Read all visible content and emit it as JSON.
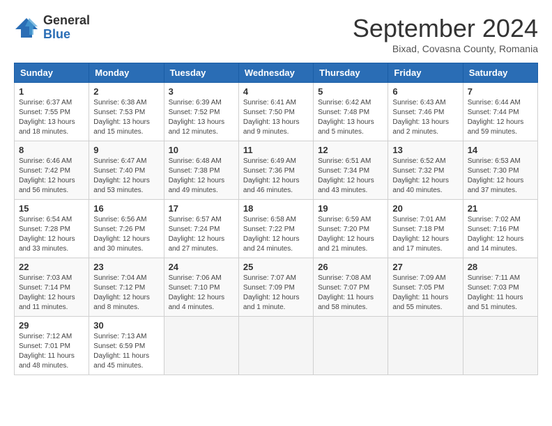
{
  "header": {
    "logo_general": "General",
    "logo_blue": "Blue",
    "month_title": "September 2024",
    "subtitle": "Bixad, Covasna County, Romania"
  },
  "weekdays": [
    "Sunday",
    "Monday",
    "Tuesday",
    "Wednesday",
    "Thursday",
    "Friday",
    "Saturday"
  ],
  "weeks": [
    [
      {
        "day": "1",
        "sunrise": "6:37 AM",
        "sunset": "7:55 PM",
        "daylight": "13 hours and 18 minutes."
      },
      {
        "day": "2",
        "sunrise": "6:38 AM",
        "sunset": "7:53 PM",
        "daylight": "13 hours and 15 minutes."
      },
      {
        "day": "3",
        "sunrise": "6:39 AM",
        "sunset": "7:52 PM",
        "daylight": "13 hours and 12 minutes."
      },
      {
        "day": "4",
        "sunrise": "6:41 AM",
        "sunset": "7:50 PM",
        "daylight": "13 hours and 9 minutes."
      },
      {
        "day": "5",
        "sunrise": "6:42 AM",
        "sunset": "7:48 PM",
        "daylight": "13 hours and 5 minutes."
      },
      {
        "day": "6",
        "sunrise": "6:43 AM",
        "sunset": "7:46 PM",
        "daylight": "13 hours and 2 minutes."
      },
      {
        "day": "7",
        "sunrise": "6:44 AM",
        "sunset": "7:44 PM",
        "daylight": "12 hours and 59 minutes."
      }
    ],
    [
      {
        "day": "8",
        "sunrise": "6:46 AM",
        "sunset": "7:42 PM",
        "daylight": "12 hours and 56 minutes."
      },
      {
        "day": "9",
        "sunrise": "6:47 AM",
        "sunset": "7:40 PM",
        "daylight": "12 hours and 53 minutes."
      },
      {
        "day": "10",
        "sunrise": "6:48 AM",
        "sunset": "7:38 PM",
        "daylight": "12 hours and 49 minutes."
      },
      {
        "day": "11",
        "sunrise": "6:49 AM",
        "sunset": "7:36 PM",
        "daylight": "12 hours and 46 minutes."
      },
      {
        "day": "12",
        "sunrise": "6:51 AM",
        "sunset": "7:34 PM",
        "daylight": "12 hours and 43 minutes."
      },
      {
        "day": "13",
        "sunrise": "6:52 AM",
        "sunset": "7:32 PM",
        "daylight": "12 hours and 40 minutes."
      },
      {
        "day": "14",
        "sunrise": "6:53 AM",
        "sunset": "7:30 PM",
        "daylight": "12 hours and 37 minutes."
      }
    ],
    [
      {
        "day": "15",
        "sunrise": "6:54 AM",
        "sunset": "7:28 PM",
        "daylight": "12 hours and 33 minutes."
      },
      {
        "day": "16",
        "sunrise": "6:56 AM",
        "sunset": "7:26 PM",
        "daylight": "12 hours and 30 minutes."
      },
      {
        "day": "17",
        "sunrise": "6:57 AM",
        "sunset": "7:24 PM",
        "daylight": "12 hours and 27 minutes."
      },
      {
        "day": "18",
        "sunrise": "6:58 AM",
        "sunset": "7:22 PM",
        "daylight": "12 hours and 24 minutes."
      },
      {
        "day": "19",
        "sunrise": "6:59 AM",
        "sunset": "7:20 PM",
        "daylight": "12 hours and 21 minutes."
      },
      {
        "day": "20",
        "sunrise": "7:01 AM",
        "sunset": "7:18 PM",
        "daylight": "12 hours and 17 minutes."
      },
      {
        "day": "21",
        "sunrise": "7:02 AM",
        "sunset": "7:16 PM",
        "daylight": "12 hours and 14 minutes."
      }
    ],
    [
      {
        "day": "22",
        "sunrise": "7:03 AM",
        "sunset": "7:14 PM",
        "daylight": "12 hours and 11 minutes."
      },
      {
        "day": "23",
        "sunrise": "7:04 AM",
        "sunset": "7:12 PM",
        "daylight": "12 hours and 8 minutes."
      },
      {
        "day": "24",
        "sunrise": "7:06 AM",
        "sunset": "7:10 PM",
        "daylight": "12 hours and 4 minutes."
      },
      {
        "day": "25",
        "sunrise": "7:07 AM",
        "sunset": "7:09 PM",
        "daylight": "12 hours and 1 minute."
      },
      {
        "day": "26",
        "sunrise": "7:08 AM",
        "sunset": "7:07 PM",
        "daylight": "11 hours and 58 minutes."
      },
      {
        "day": "27",
        "sunrise": "7:09 AM",
        "sunset": "7:05 PM",
        "daylight": "11 hours and 55 minutes."
      },
      {
        "day": "28",
        "sunrise": "7:11 AM",
        "sunset": "7:03 PM",
        "daylight": "11 hours and 51 minutes."
      }
    ],
    [
      {
        "day": "29",
        "sunrise": "7:12 AM",
        "sunset": "7:01 PM",
        "daylight": "11 hours and 48 minutes."
      },
      {
        "day": "30",
        "sunrise": "7:13 AM",
        "sunset": "6:59 PM",
        "daylight": "11 hours and 45 minutes."
      },
      null,
      null,
      null,
      null,
      null
    ]
  ]
}
